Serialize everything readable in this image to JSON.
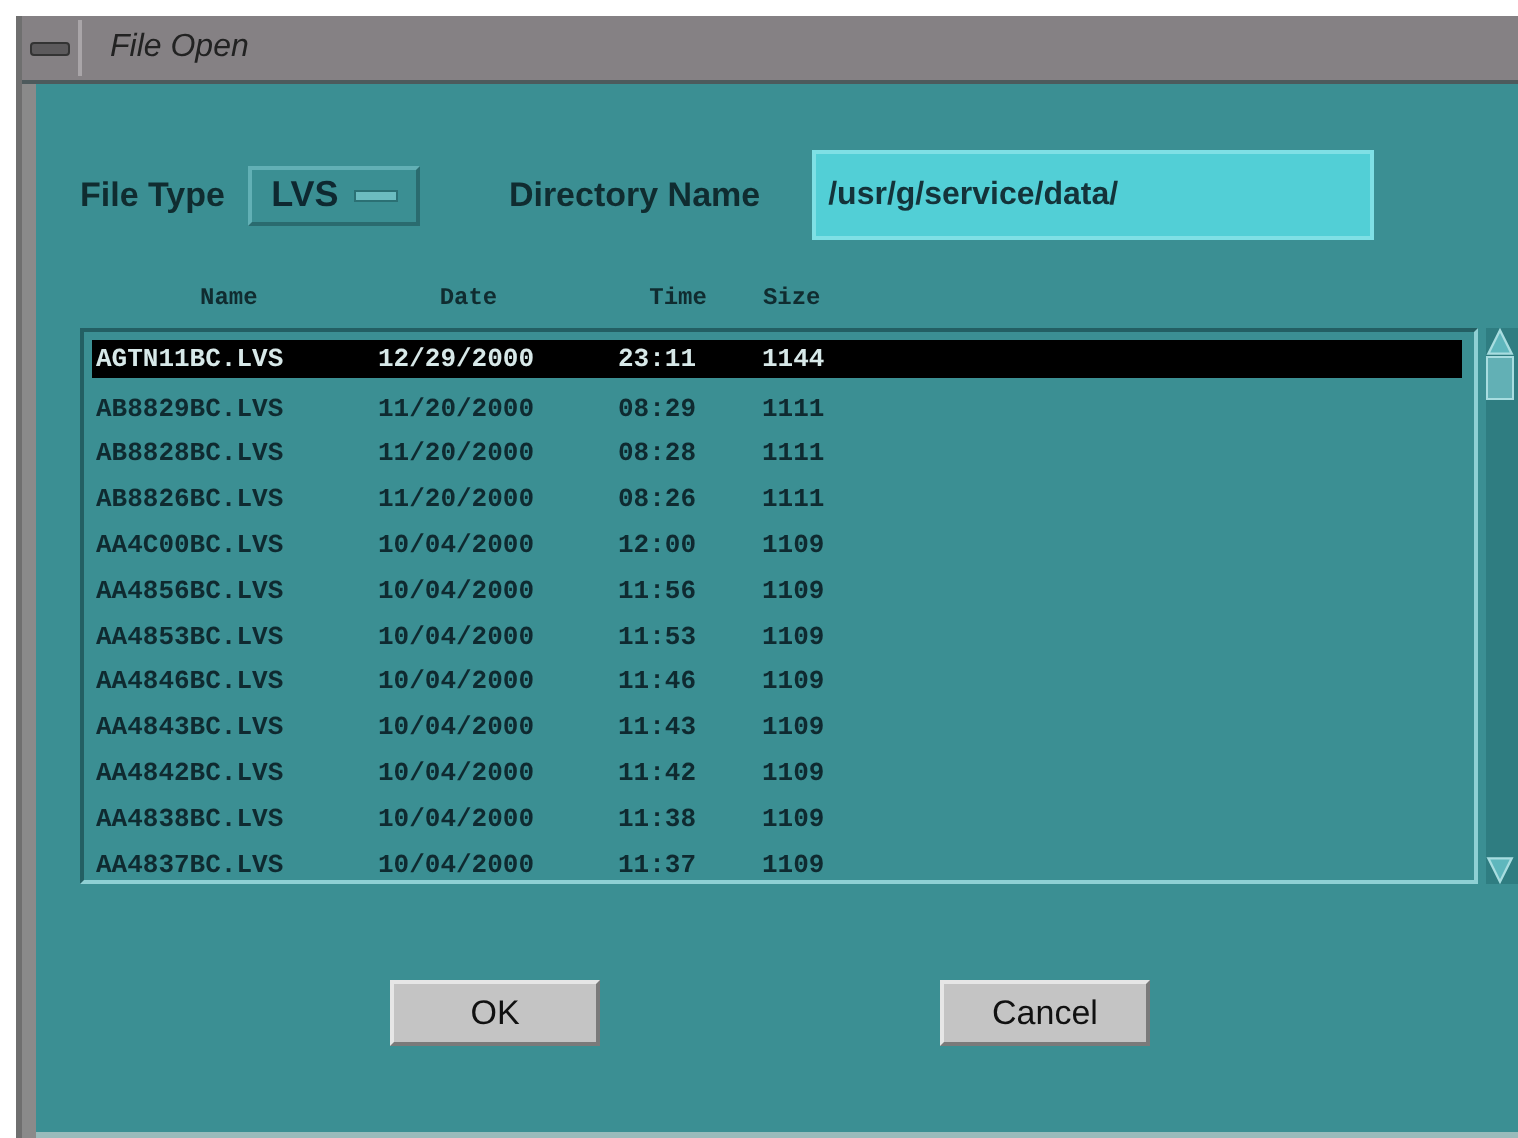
{
  "window": {
    "title": "File Open"
  },
  "file_type": {
    "label": "File Type",
    "value": "LVS"
  },
  "directory": {
    "label": "Directory Name",
    "value": "/usr/g/service/data/"
  },
  "table": {
    "columns": [
      "Name",
      "Date",
      "Time",
      "Size"
    ],
    "rows": [
      {
        "cells": [
          "AGTN11BC.LVS",
          "12/29/2000",
          "23:11",
          "1144"
        ],
        "selected": true
      },
      {
        "cells": [
          "AB8829BC.LVS",
          "11/20/2000",
          "08:29",
          "1111"
        ],
        "selected": false
      },
      {
        "cells": [
          "AB8828BC.LVS",
          "11/20/2000",
          "08:28",
          "1111"
        ],
        "selected": false
      },
      {
        "cells": [
          "AB8826BC.LVS",
          "11/20/2000",
          "08:26",
          "1111"
        ],
        "selected": false
      },
      {
        "cells": [
          "AA4C00BC.LVS",
          "10/04/2000",
          "12:00",
          "1109"
        ],
        "selected": false
      },
      {
        "cells": [
          "AA4856BC.LVS",
          "10/04/2000",
          "11:56",
          "1109"
        ],
        "selected": false
      },
      {
        "cells": [
          "AA4853BC.LVS",
          "10/04/2000",
          "11:53",
          "1109"
        ],
        "selected": false
      },
      {
        "cells": [
          "AA4846BC.LVS",
          "10/04/2000",
          "11:46",
          "1109"
        ],
        "selected": false
      },
      {
        "cells": [
          "AA4843BC.LVS",
          "10/04/2000",
          "11:43",
          "1109"
        ],
        "selected": false
      },
      {
        "cells": [
          "AA4842BC.LVS",
          "10/04/2000",
          "11:42",
          "1109"
        ],
        "selected": false
      },
      {
        "cells": [
          "AA4838BC.LVS",
          "10/04/2000",
          "11:38",
          "1109"
        ],
        "selected": false
      },
      {
        "cells": [
          "AA4837BC.LVS",
          "10/04/2000",
          "11:37",
          "1109"
        ],
        "selected": false
      }
    ]
  },
  "buttons": [
    "OK",
    "Cancel"
  ]
}
